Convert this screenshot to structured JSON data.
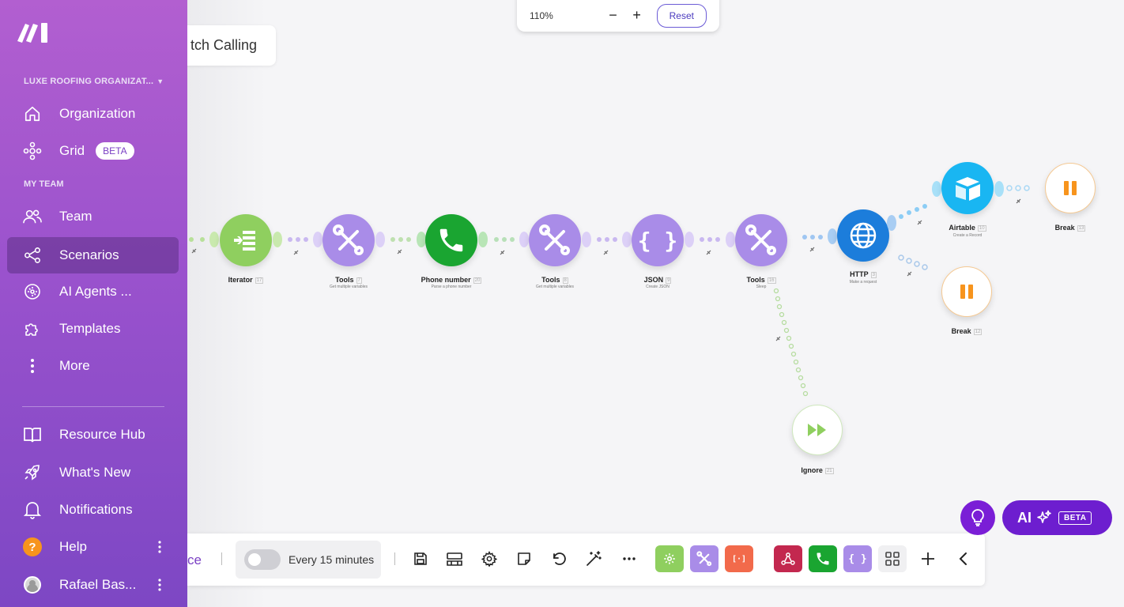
{
  "zoom": {
    "level": "110%",
    "minus": "−",
    "plus": "+",
    "reset_label": "Reset"
  },
  "scenario_title": "tch Calling",
  "sidebar": {
    "org_name": "LUXE ROOFING ORGANIZAT...",
    "items_top": [
      {
        "label": "Organization",
        "icon": "home-icon"
      },
      {
        "label": "Grid",
        "icon": "grid-icon",
        "badge": "BETA"
      }
    ],
    "team_section": "MY TEAM",
    "items_team": [
      {
        "label": "Team",
        "icon": "team-icon"
      },
      {
        "label": "Scenarios",
        "icon": "share-icon",
        "active": true
      },
      {
        "label": "AI Agents ...",
        "icon": "ai-agents-icon"
      },
      {
        "label": "Templates",
        "icon": "puzzle-icon"
      },
      {
        "label": "More",
        "icon": "more-vertical-icon"
      }
    ],
    "items_bottom": [
      {
        "label": "Resource Hub",
        "icon": "book-icon"
      },
      {
        "label": "What's New",
        "icon": "rocket-icon"
      },
      {
        "label": "Notifications",
        "icon": "bell-icon"
      },
      {
        "label": "Help",
        "icon": "help-icon",
        "icon_text": "?"
      },
      {
        "label": "Rafael Bas...",
        "icon": "avatar"
      }
    ]
  },
  "nodes": [
    {
      "name": "Iterator",
      "num": "17",
      "sub": "",
      "color": "#8fcf5f"
    },
    {
      "name": "Tools",
      "num": "7",
      "sub": "Get multiple variables",
      "color": "#a98ce8"
    },
    {
      "name": "Phone number",
      "num": "20",
      "sub": "Parse a phone number",
      "color": "#1aa531"
    },
    {
      "name": "Tools",
      "num": "8",
      "sub": "Get multiple variables",
      "color": "#a98ce8"
    },
    {
      "name": "JSON",
      "num": "9",
      "sub": "Create JSON",
      "color": "#a98ce8"
    },
    {
      "name": "Tools",
      "num": "16",
      "sub": "Sleep",
      "color": "#a98ce8"
    },
    {
      "name": "HTTP",
      "num": "3",
      "sub": "Make a request",
      "color": "#1c7ddb"
    },
    {
      "name": "Airtable",
      "num": "10",
      "sub": "Create a Record",
      "color": "#19b6f2"
    },
    {
      "name": "Break",
      "num": "13",
      "sub": "",
      "color": "#f7941d"
    },
    {
      "name": "Break",
      "num": "12",
      "sub": "",
      "color": "#f7941d"
    },
    {
      "name": "Ignore",
      "num": "21",
      "sub": "",
      "color": "#8fcf5f"
    }
  ],
  "toolbar": {
    "partial_text": "ce",
    "schedule_label": "Every 15 minutes",
    "icons": [
      "save-icon",
      "devtool-icon",
      "settings-icon",
      "notes-icon",
      "undo-icon",
      "magic-wand-icon",
      "more-horizontal-icon"
    ],
    "modules": [
      {
        "icon": "gear-icon",
        "color": "#8fcf5f"
      },
      {
        "icon": "tools-icon",
        "color": "#a98ce8"
      },
      {
        "icon": "text-parser-icon",
        "color": "#f26a4b",
        "glyph": "[·]"
      },
      {
        "icon": "webhook-icon",
        "color": "#c3284f"
      },
      {
        "icon": "phone-icon",
        "color": "#1aa531"
      },
      {
        "icon": "json-icon",
        "color": "#a98ce8",
        "glyph": "{ }"
      },
      {
        "icon": "apps-grid-icon",
        "color": "#f0f0f2"
      }
    ]
  },
  "ai": {
    "label": "AI",
    "badge": "BETA"
  }
}
